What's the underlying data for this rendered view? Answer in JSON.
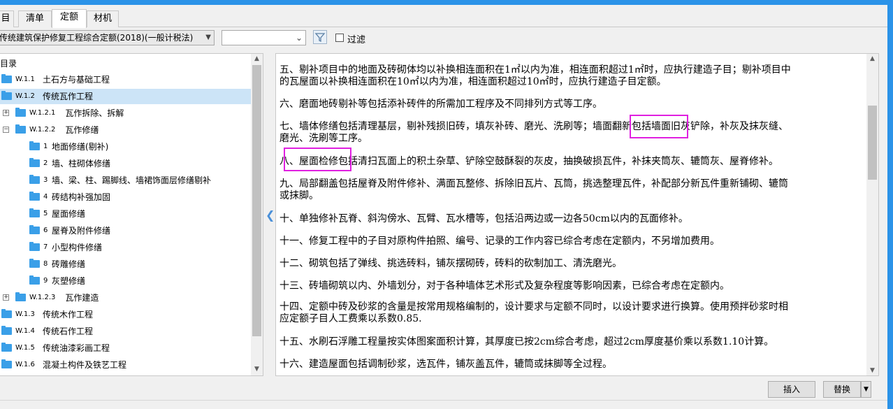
{
  "tabs": [
    {
      "label": "目"
    },
    {
      "label": "清单"
    },
    {
      "label": "定额"
    },
    {
      "label": "材机"
    }
  ],
  "toolbar": {
    "norm_select_value": "传统建筑保护修复工程综合定额(2018)(一般计税法)",
    "second_select_value": "",
    "filter_label": "过滤"
  },
  "tree": {
    "header": "目录",
    "items": [
      {
        "code": "W.1.1",
        "label": "土石方与基础工程",
        "expander": ""
      },
      {
        "code": "W.1.2",
        "label": "传统瓦作工程",
        "expander": ""
      },
      {
        "code": "W.1.2.1",
        "label": "瓦作拆除、拆解",
        "expander": "+"
      },
      {
        "code": "W.1.2.2",
        "label": "瓦作修缮",
        "expander": "−"
      },
      {
        "code": "1",
        "label": "地面修缮(剔补)",
        "expander": ""
      },
      {
        "code": "2",
        "label": "墙、柱砌体修缮",
        "expander": ""
      },
      {
        "code": "3",
        "label": "墙、梁、柱、踢脚线、墙裙饰面层修缮剔补",
        "expander": ""
      },
      {
        "code": "4",
        "label": "砖结构补强加固",
        "expander": ""
      },
      {
        "code": "5",
        "label": "屋面修缮",
        "expander": ""
      },
      {
        "code": "6",
        "label": "屋脊及附件修缮",
        "expander": ""
      },
      {
        "code": "7",
        "label": "小型构件修缮",
        "expander": ""
      },
      {
        "code": "8",
        "label": "砖雕修缮",
        "expander": ""
      },
      {
        "code": "9",
        "label": "灰塑修缮",
        "expander": ""
      },
      {
        "code": "W.1.2.3",
        "label": "瓦作建造",
        "expander": "+"
      },
      {
        "code": "W.1.3",
        "label": "传统木作工程",
        "expander": ""
      },
      {
        "code": "W.1.4",
        "label": "传统石作工程",
        "expander": ""
      },
      {
        "code": "W.1.5",
        "label": "传统油漆彩画工程",
        "expander": ""
      },
      {
        "code": "W.1.6",
        "label": "混凝土构件及铁艺工程",
        "expander": ""
      }
    ]
  },
  "content": {
    "paragraphs": [
      {
        "line1": "五、剔补项目中的地面及砖砌体均以补换相连面积在1㎡以内为准，相连面积超过1㎡时，应执行建造子目；剔补项目中",
        "line2": "的瓦屋面以补换相连面积在10㎡以内为准，相连面积超过10㎡时，应执行建造子目定额。"
      },
      {
        "line1": "六、磨面地砖剔补等包括添补砖件的所需加工程序及不同排列方式等工序。",
        "line2": ""
      },
      {
        "line1": "七、墙体修缮包括清理基层，剔补残损旧砖，填灰补砖、磨光、洗刷等；墙面翻新包括墙面旧灰铲除，补灰及抹灰缝、",
        "line2": "磨光、洗刷等工序。"
      },
      {
        "line1": "八、屋面检修包括清扫瓦面上的积土杂草、铲除空鼓酥裂的灰皮，抽换破损瓦件，补抹夹筒灰、辘筒灰、屋脊修补。",
        "line2": ""
      },
      {
        "line1": "九、局部翻盖包括屋脊及附件修补、满面瓦整修、拆除旧瓦片、瓦筒，挑选整理瓦件，补配部分新瓦件重新铺砌、辘筒",
        "line2": "或抹脚。"
      },
      {
        "line1": "十、单独修补瓦脊、斜沟傍水、瓦臂、瓦水槽等，包括沿两边或一边各50cm以内的瓦面修补。",
        "line2": ""
      },
      {
        "line1": "十一、修复工程中的子目对原构件拍照、编号、记录的工作内容已综合考虑在定额内，不另增加费用。",
        "line2": ""
      },
      {
        "line1": "十二、砌筑包括了弹线、挑选砖料，铺灰摆砌砖，砖料的砍制加工、清洗磨光。",
        "line2": ""
      },
      {
        "line1": "十三、砖墙砌筑以内、外墙划分，对于各种墙体艺术形式及复杂程度等影响因素，已综合考虑在定额内。",
        "line2": ""
      },
      {
        "line1": "十四、定额中砖及砂浆的含量是按常用规格编制的，设计要求与定额不同时，以设计要求进行换算。使用预拌砂浆时相",
        "line2": "应定额子目人工费乘以系数0.85."
      },
      {
        "line1": "十五、水刷石浮雕工程量按实体图案面积计算，其厚度已按2cm综合考虑，超过2cm厚度基价乘以系数1.10计算。",
        "line2": ""
      },
      {
        "line1": "十六、建造屋面包括调制砂浆，选瓦件，铺灰盖瓦件，辘筒或抹脚等全过程。",
        "line2": ""
      }
    ]
  },
  "buttons": {
    "insert": "插入",
    "replace": "替换"
  },
  "colors": {
    "accent": "#2b93e8",
    "highlight_box": "#e020e0",
    "selected_row": "#cce4f7",
    "folder": "#3a9fe8"
  }
}
